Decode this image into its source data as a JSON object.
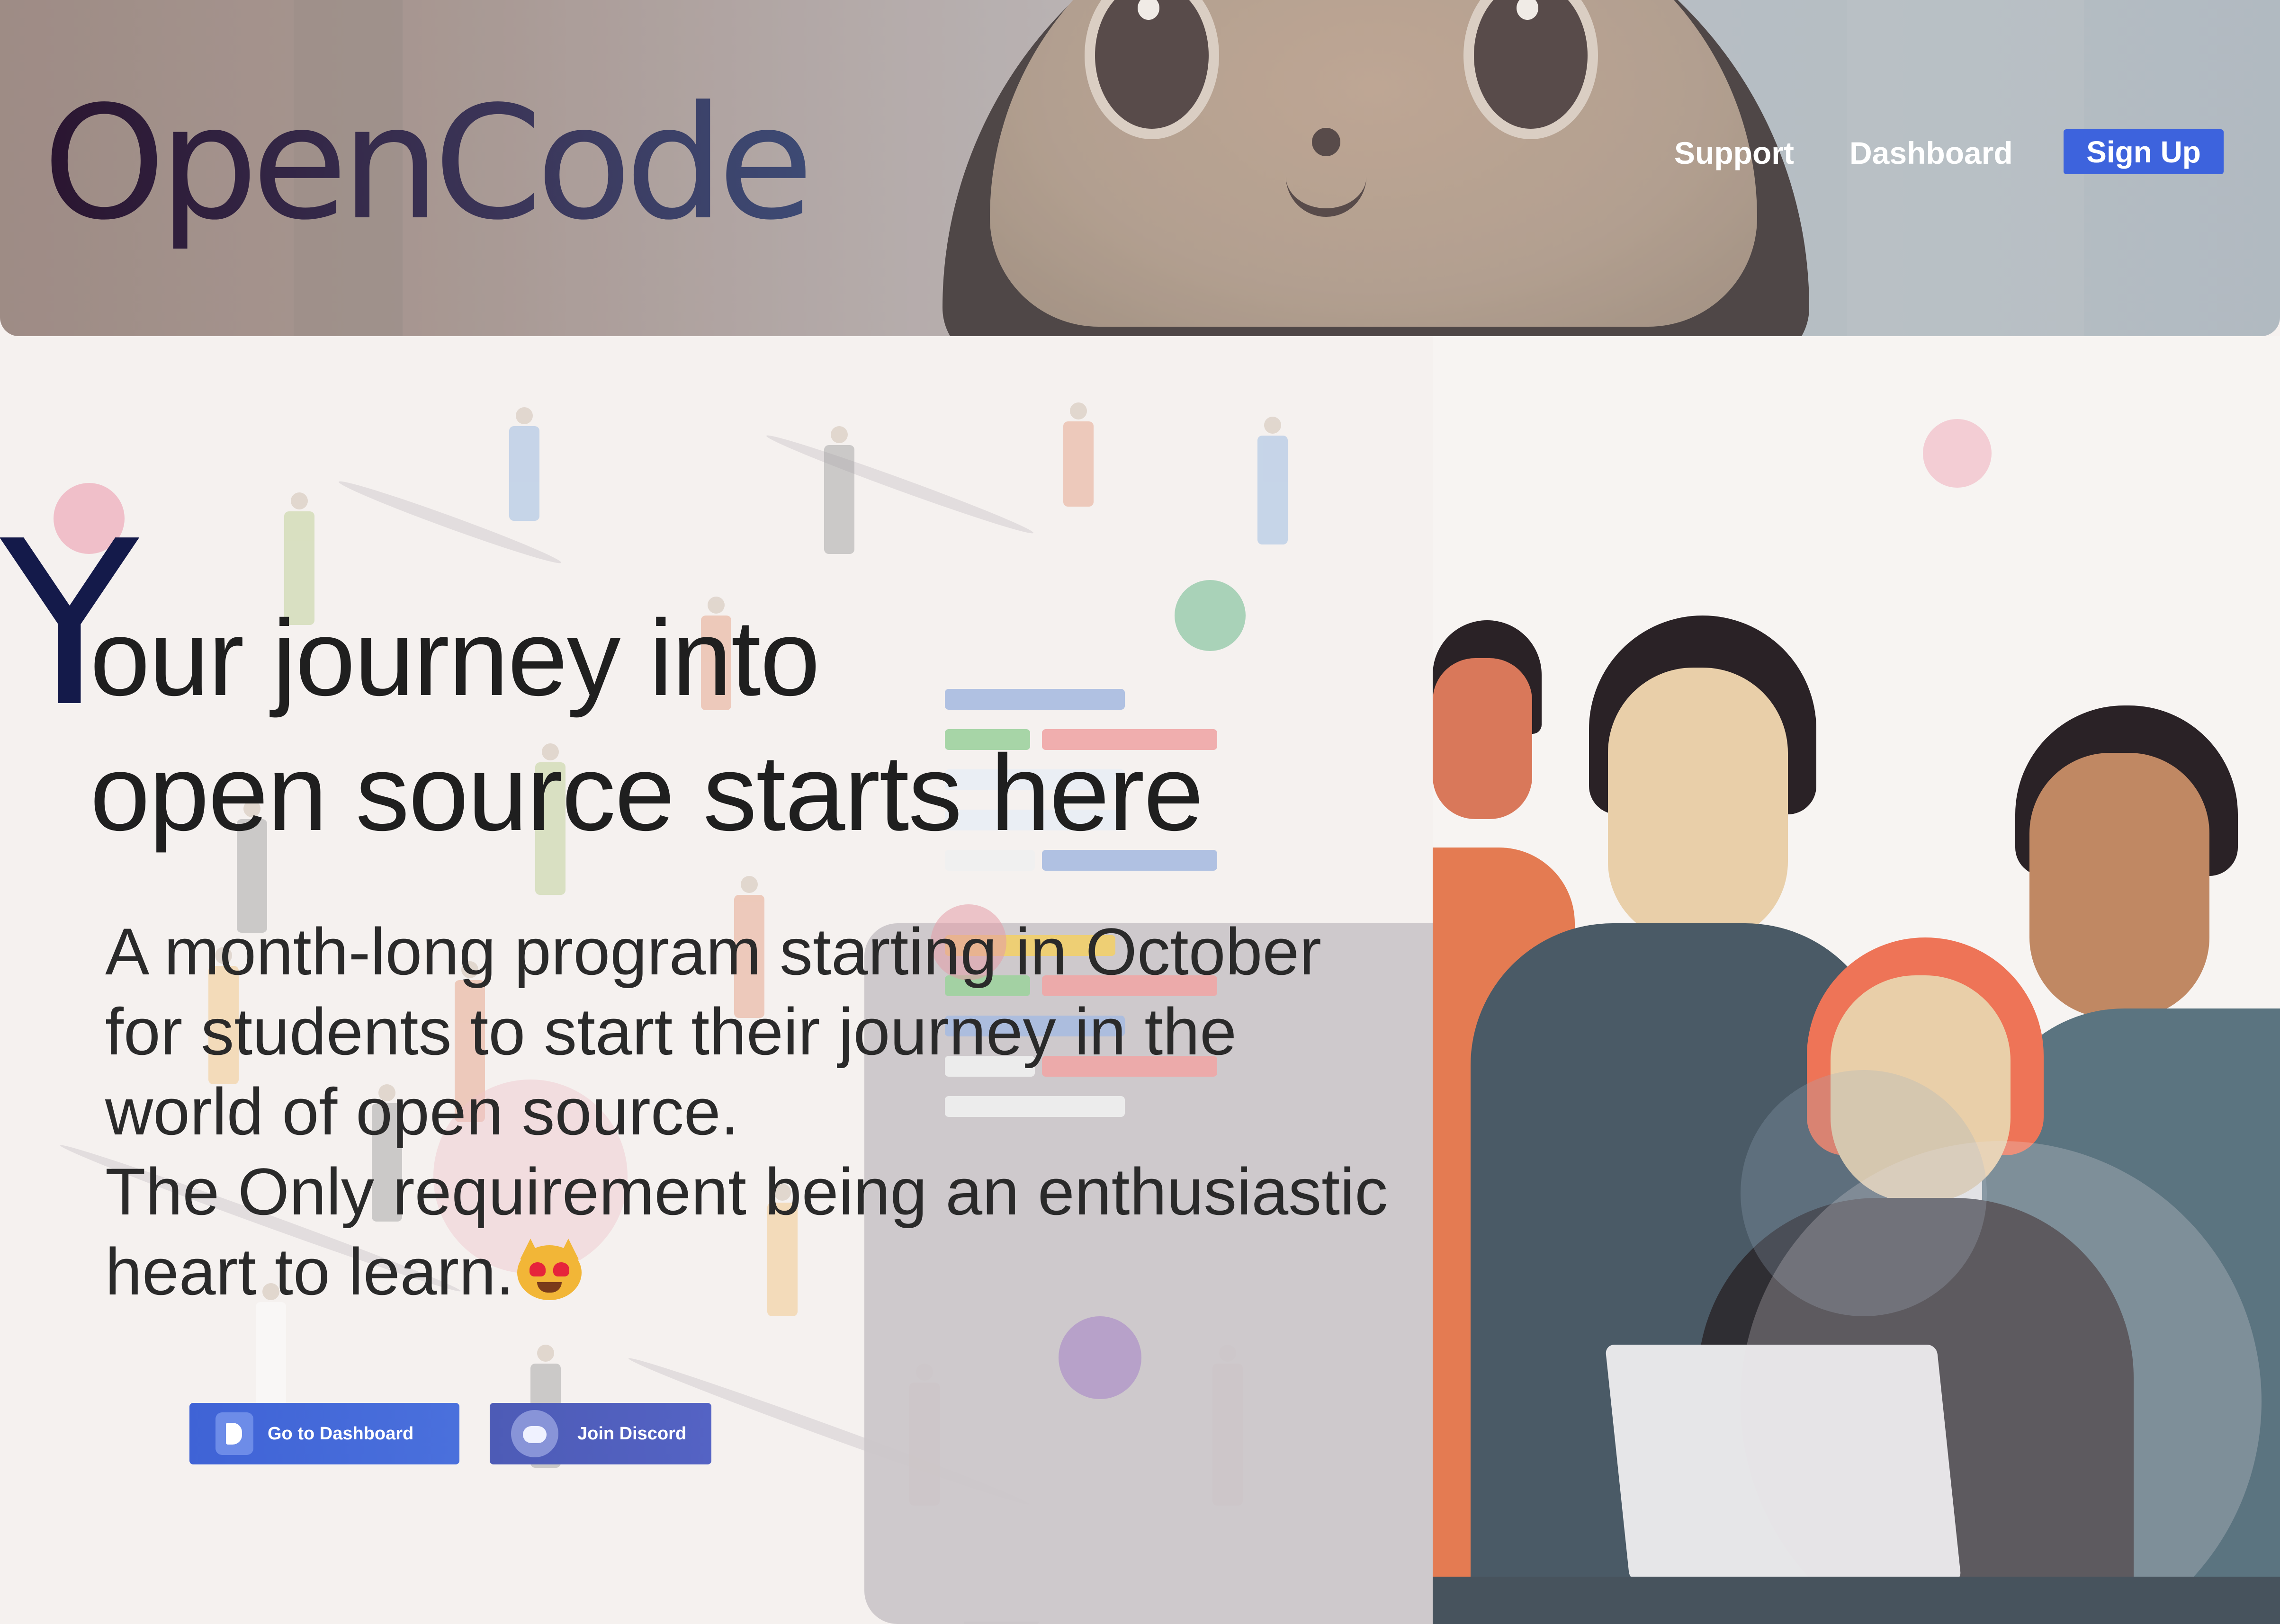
{
  "header": {
    "logo_text": "OpenCode",
    "nav": {
      "support": "Support",
      "dashboard": "Dashboard",
      "signup": "Sign Up"
    }
  },
  "hero": {
    "title_initial": "Y",
    "title_line1": "our journey into",
    "title_line2": "open source starts here",
    "description_line1": "A month-long program starting in October for students to start their journey in the world of open source.",
    "description_line2": "The Only requirement being an enthusiastic heart to learn.",
    "emoji": "smiling-cat-heart-eyes-icon",
    "buttons": {
      "dashboard": "Go to Dashboard",
      "discord": "Join Discord"
    }
  },
  "colors": {
    "accent": "#3d63dd",
    "heading": "#1f1f1f",
    "initial": "#141a4a"
  }
}
